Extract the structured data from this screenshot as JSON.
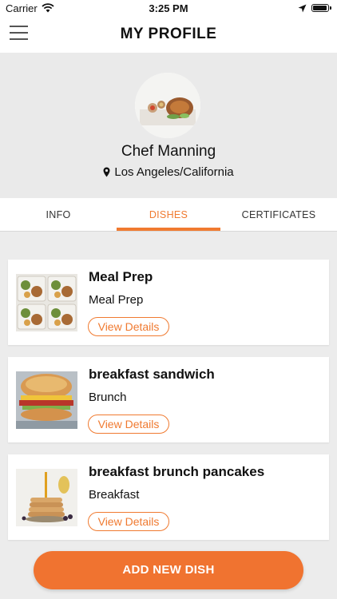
{
  "status_bar": {
    "carrier": "Carrier",
    "time": "3:25 PM"
  },
  "nav": {
    "title": "MY PROFILE"
  },
  "profile": {
    "name": "Chef Manning",
    "location": "Los Angeles/California"
  },
  "tabs": [
    {
      "label": "INFO",
      "active": false
    },
    {
      "label": "DISHES",
      "active": true
    },
    {
      "label": "CERTIFICATES",
      "active": false
    }
  ],
  "dishes": [
    {
      "title": "Meal Prep",
      "category": "Meal Prep",
      "button": "View Details"
    },
    {
      "title": "breakfast sandwich",
      "category": "Brunch",
      "button": "View Details"
    },
    {
      "title": "breakfast brunch pancakes",
      "category": "Breakfast",
      "button": "View Details"
    }
  ],
  "actions": {
    "add_dish": "ADD NEW DISH"
  },
  "colors": {
    "accent": "#f07a30"
  }
}
